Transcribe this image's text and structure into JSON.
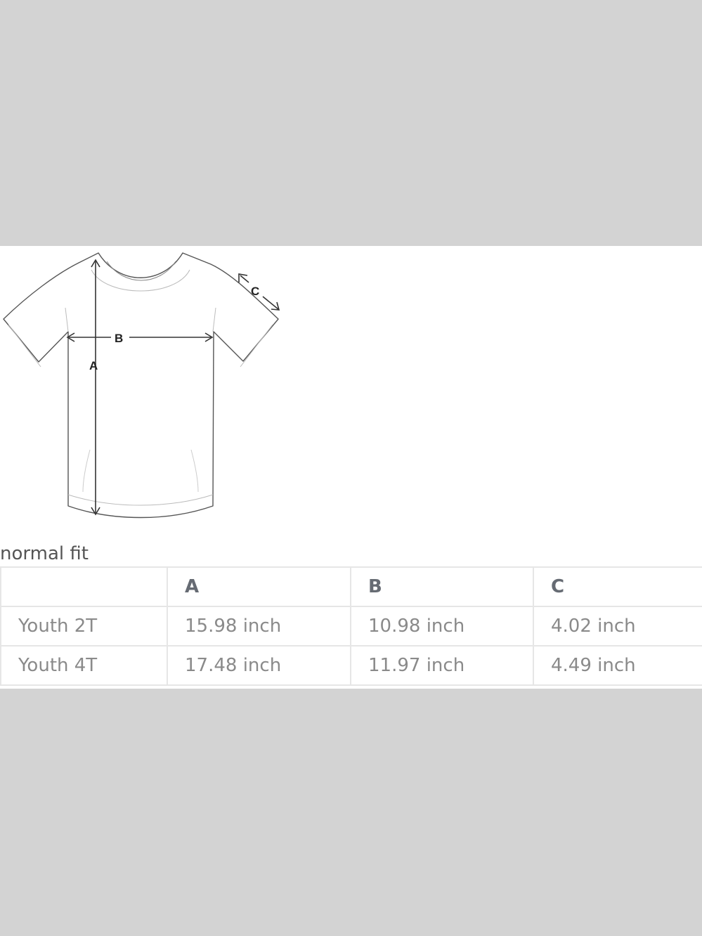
{
  "diagram": {
    "labels": {
      "a": "A",
      "b": "B",
      "c": "C"
    }
  },
  "fit_label": "normal fit",
  "table": {
    "headers": [
      "",
      "A",
      "B",
      "C"
    ],
    "rows": [
      {
        "size": "Youth 2T",
        "a": "15.98 inch",
        "b": "10.98 inch",
        "c": "4.02 inch"
      },
      {
        "size": "Youth 4T",
        "a": "17.48 inch",
        "b": "11.97 inch",
        "c": "4.49 inch"
      }
    ]
  },
  "colors": {
    "background": "#d3d3d3",
    "panel": "#ffffff",
    "header_text": "#666b73",
    "cell_text": "#8a8a8a",
    "border": "#e6e6e6",
    "outline": "#555555"
  }
}
